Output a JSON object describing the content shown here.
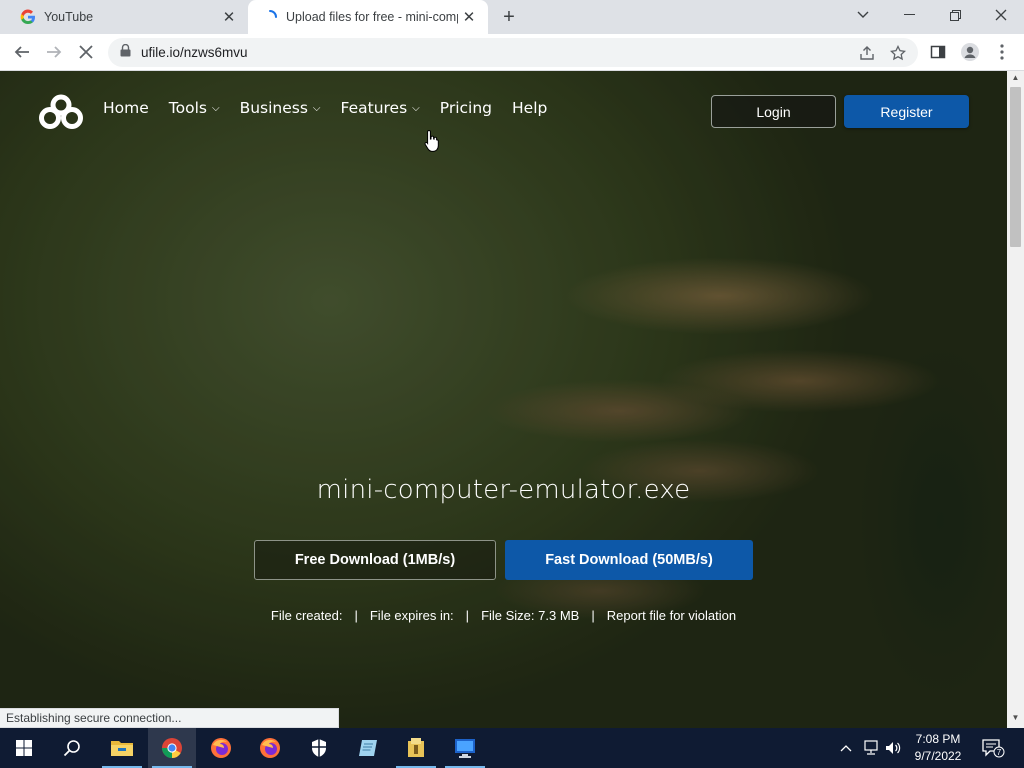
{
  "browser": {
    "tabs": [
      {
        "title": "YouTube",
        "favicon": "google-icon",
        "active": false
      },
      {
        "title": "Upload files for free - mini-comp",
        "favicon": "loading-spinner-icon",
        "active": true
      }
    ],
    "address_bar": {
      "url": "ufile.io/nzws6mvu"
    },
    "status_text": "Establishing secure connection..."
  },
  "site": {
    "nav": [
      {
        "label": "Home",
        "has_dropdown": false
      },
      {
        "label": "Tools",
        "has_dropdown": true
      },
      {
        "label": "Business",
        "has_dropdown": true
      },
      {
        "label": "Features",
        "has_dropdown": true
      },
      {
        "label": "Pricing",
        "has_dropdown": false
      },
      {
        "label": "Help",
        "has_dropdown": false
      }
    ],
    "login_label": "Login",
    "register_label": "Register",
    "file": {
      "name": "mini-computer-emulator.exe",
      "free_download_label": "Free Download (1MB/s)",
      "fast_download_label": "Fast Download (50MB/s)",
      "created_label": "File created:",
      "expires_label": "File expires in:",
      "size_label": "File Size: 7.3 MB",
      "report_label": "Report file for violation",
      "separator": "|"
    },
    "colors": {
      "accent_blue": "#0d58a8"
    }
  },
  "taskbar": {
    "time": "7:08 PM",
    "date": "9/7/2022",
    "notification_count": "7",
    "apps": [
      "start-icon",
      "search-icon",
      "file-explorer-icon",
      "chrome-icon",
      "firefox-icon",
      "firefox-icon",
      "windows-security-icon",
      "notepad-icon",
      "archive-icon",
      "remote-desktop-icon"
    ]
  }
}
